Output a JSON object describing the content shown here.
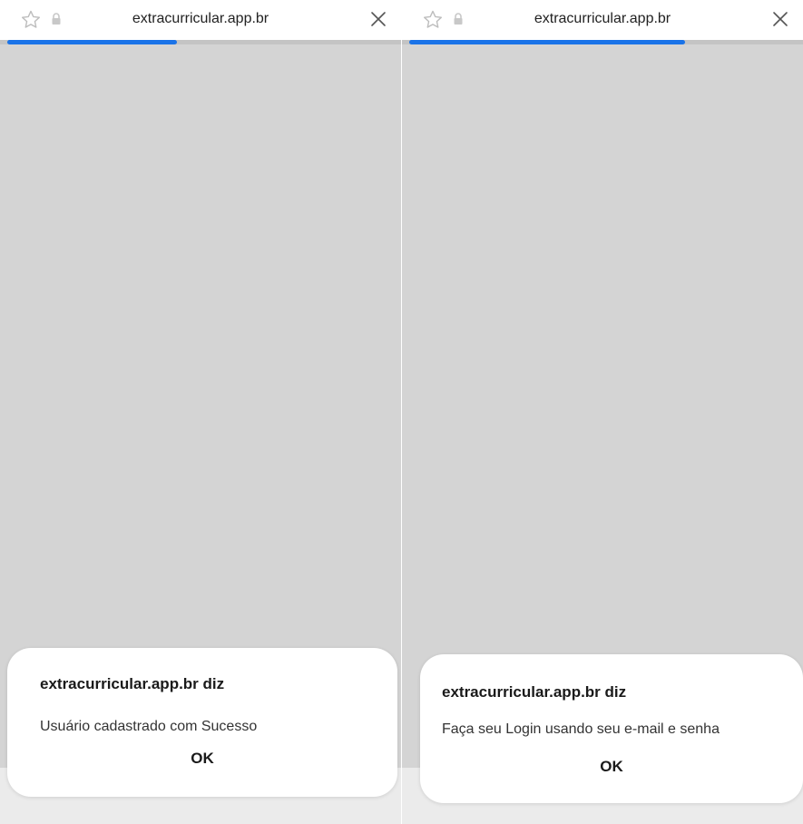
{
  "screens": [
    {
      "urlbar": {
        "domain": "extracurricular.app.br",
        "star_icon": "star-outline-icon",
        "lock_icon": "lock-icon",
        "close_icon": "close-icon"
      },
      "progress": 0.43,
      "dialog": {
        "title": "extracurricular.app.br diz",
        "message": "Usuário cadastrado com Sucesso",
        "ok_label": "OK"
      }
    },
    {
      "urlbar": {
        "domain": "extracurricular.app.br",
        "star_icon": "star-outline-icon",
        "lock_icon": "lock-icon",
        "close_icon": "close-icon"
      },
      "progress": 0.7,
      "dialog": {
        "title": "extracurricular.app.br diz",
        "message": "Faça seu Login usando seu e-mail e senha",
        "ok_label": "OK"
      }
    }
  ],
  "colors": {
    "progress": "#1a73e8",
    "page_background": "#d4d4d4",
    "dialog_background": "#ffffff"
  }
}
